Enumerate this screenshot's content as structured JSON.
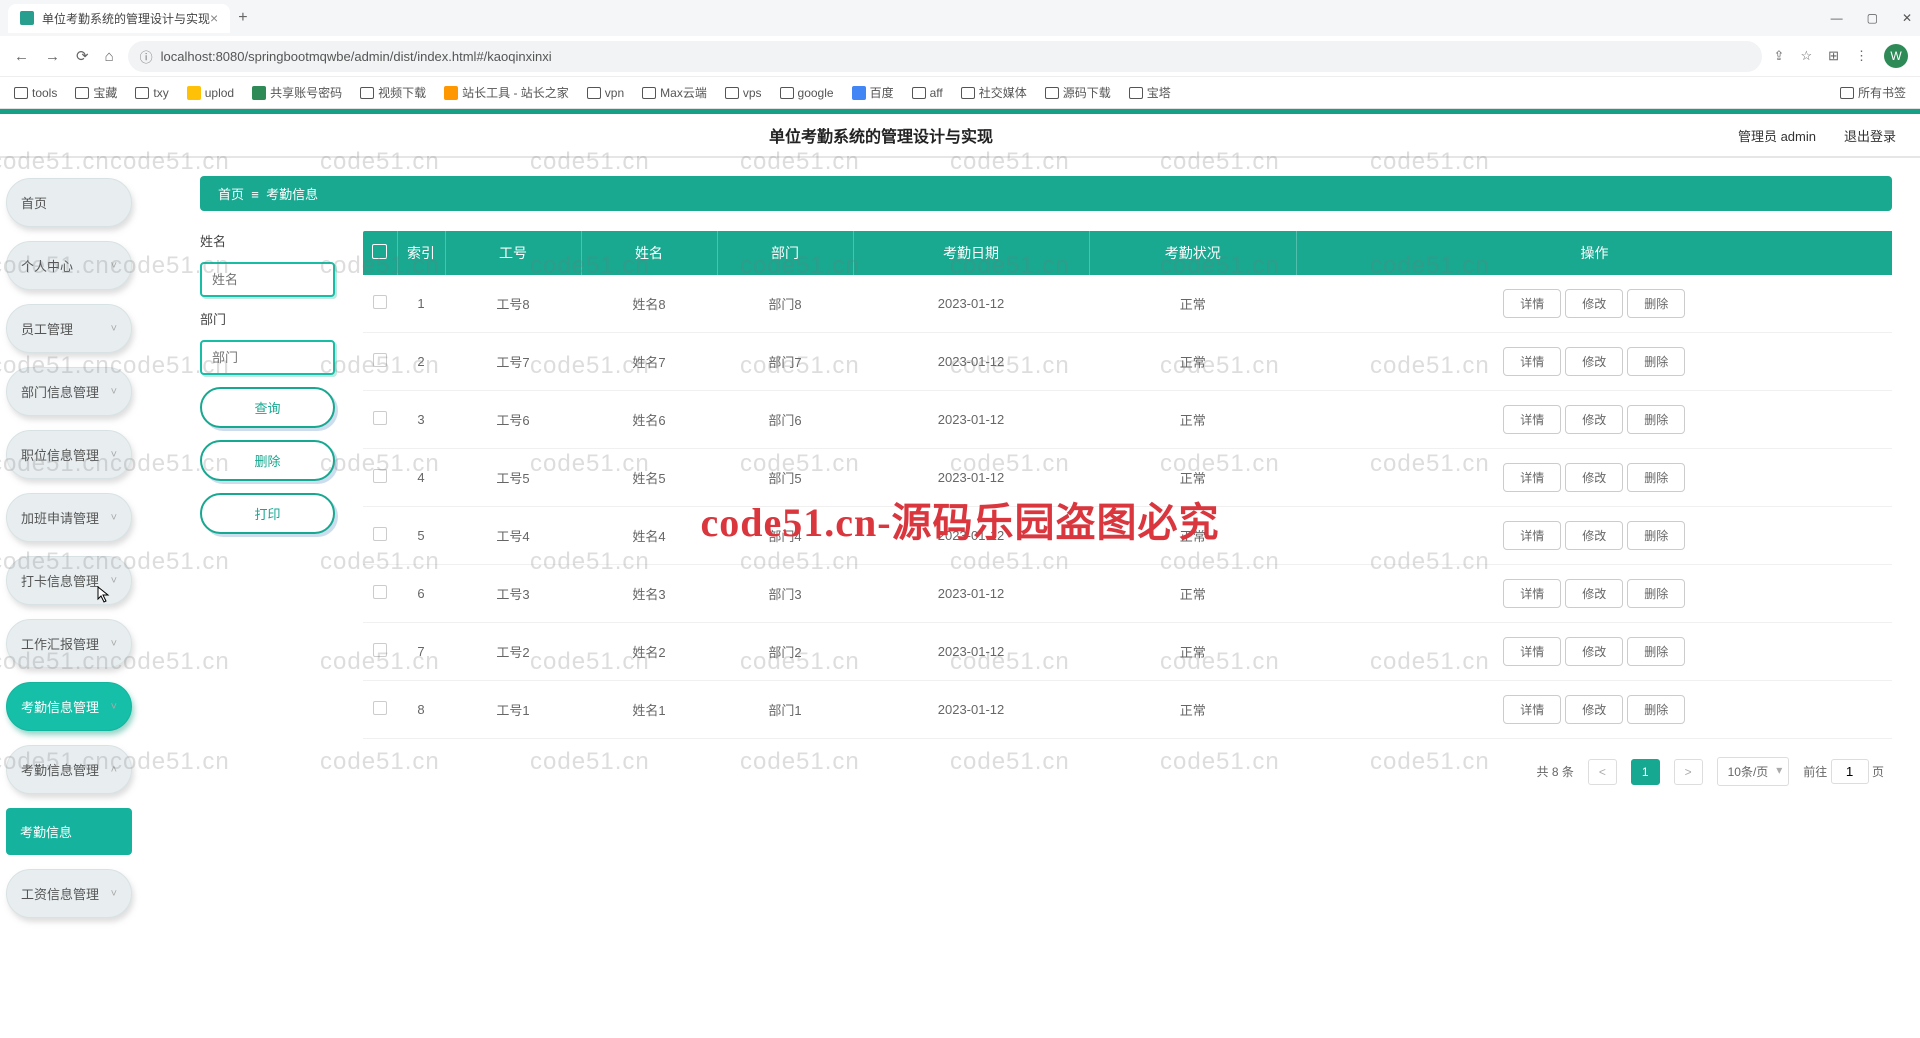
{
  "browser": {
    "tab_title": "单位考勤系统的管理设计与实现",
    "url_insecure_icon": "ⓘ",
    "url": "localhost:8080/springbootmqwbe/admin/dist/index.html#/kaoqinxinxi",
    "new_tab": "+",
    "close": "×",
    "win_min": "—",
    "win_max": "▢",
    "win_close": "✕",
    "nav_back": "←",
    "nav_fwd": "→",
    "nav_reload": "⟳",
    "nav_home": "⌂",
    "ext_icon": "⊞",
    "user_letter": "W",
    "bookmarks": [
      {
        "label": "tools",
        "ico": "fold"
      },
      {
        "label": "宝藏",
        "ico": "fold"
      },
      {
        "label": "txy",
        "ico": "fold"
      },
      {
        "label": "uplod",
        "ico": "y"
      },
      {
        "label": "共享账号密码",
        "ico": "g"
      },
      {
        "label": "视频下载",
        "ico": "fold"
      },
      {
        "label": "站长工具 - 站长之家",
        "ico": "o"
      },
      {
        "label": "vpn",
        "ico": "fold"
      },
      {
        "label": "Max云端",
        "ico": "fold"
      },
      {
        "label": "vps",
        "ico": "fold"
      },
      {
        "label": "google",
        "ico": "fold"
      },
      {
        "label": "百度",
        "ico": "b"
      },
      {
        "label": "aff",
        "ico": "fold"
      },
      {
        "label": "社交媒体",
        "ico": "fold"
      },
      {
        "label": "源码下载",
        "ico": "fold"
      },
      {
        "label": "宝塔",
        "ico": "fold"
      }
    ],
    "bookmarks_right": "所有书签"
  },
  "header": {
    "title": "单位考勤系统的管理设计与实现",
    "user": "管理员 admin",
    "logout": "退出登录"
  },
  "sidebar": {
    "items": [
      {
        "label": "首页",
        "chev": false
      },
      {
        "label": "个人中心",
        "chev": true
      },
      {
        "label": "员工管理",
        "chev": true
      },
      {
        "label": "部门信息管理",
        "chev": true
      },
      {
        "label": "职位信息管理",
        "chev": true
      },
      {
        "label": "加班申请管理",
        "chev": true
      },
      {
        "label": "打卡信息管理",
        "chev": true
      },
      {
        "label": "工作汇报管理",
        "chev": true
      },
      {
        "label": "考勤信息管理",
        "chev": true,
        "active": true
      },
      {
        "label": "考勤信息管理",
        "chev": true,
        "expanded": true
      },
      {
        "label": "工资信息管理",
        "chev": true
      }
    ],
    "sub_item": "考勤信息"
  },
  "breadcrumb": {
    "home": "首页",
    "sep": "≡",
    "current": "考勤信息"
  },
  "filters": {
    "name_label": "姓名",
    "name_placeholder": "姓名",
    "dept_label": "部门",
    "dept_placeholder": "部门",
    "btn_search": "查询",
    "btn_delete": "删除",
    "btn_print": "打印"
  },
  "table": {
    "columns": [
      "",
      "索引",
      "工号",
      "姓名",
      "部门",
      "考勤日期",
      "考勤状况",
      "操作"
    ],
    "rows": [
      {
        "idx": "1",
        "gh": "工号8",
        "name": "姓名8",
        "dept": "部门8",
        "date": "2023-01-12",
        "status": "正常"
      },
      {
        "idx": "2",
        "gh": "工号7",
        "name": "姓名7",
        "dept": "部门7",
        "date": "2023-01-12",
        "status": "正常"
      },
      {
        "idx": "3",
        "gh": "工号6",
        "name": "姓名6",
        "dept": "部门6",
        "date": "2023-01-12",
        "status": "正常"
      },
      {
        "idx": "4",
        "gh": "工号5",
        "name": "姓名5",
        "dept": "部门5",
        "date": "2023-01-12",
        "status": "正常"
      },
      {
        "idx": "5",
        "gh": "工号4",
        "name": "姓名4",
        "dept": "部门4",
        "date": "2023-01-12",
        "status": "正常"
      },
      {
        "idx": "6",
        "gh": "工号3",
        "name": "姓名3",
        "dept": "部门3",
        "date": "2023-01-12",
        "status": "正常"
      },
      {
        "idx": "7",
        "gh": "工号2",
        "name": "姓名2",
        "dept": "部门2",
        "date": "2023-01-12",
        "status": "正常"
      },
      {
        "idx": "8",
        "gh": "工号1",
        "name": "姓名1",
        "dept": "部门1",
        "date": "2023-01-12",
        "status": "正常"
      }
    ],
    "op_detail": "详情",
    "op_edit": "修改",
    "op_delete": "删除"
  },
  "pager": {
    "total": "共 8 条",
    "prev": "<",
    "page": "1",
    "next": ">",
    "size": "10条/页",
    "goto_pre": "前往",
    "goto_val": "1",
    "goto_suf": "页"
  },
  "watermark": {
    "text": "code51.cn",
    "big": "code51.cn-源码乐园盗图必究"
  }
}
